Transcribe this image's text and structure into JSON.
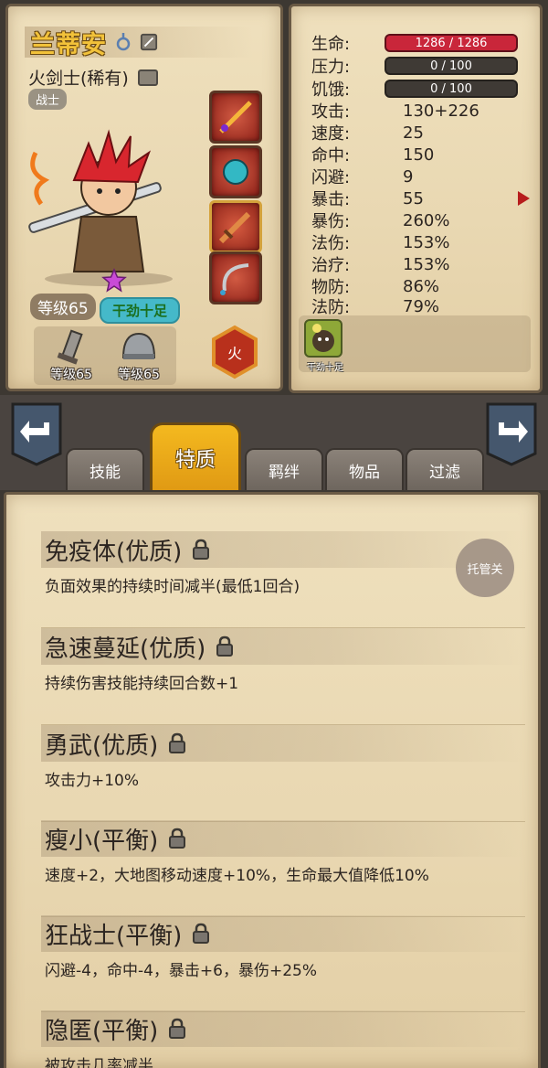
{
  "character": {
    "name": "兰蒂安",
    "class_line": "火剑士(稀有)",
    "role": "战士",
    "level": "等级65",
    "trait_tag": "干劲十足",
    "element": "火",
    "gear": [
      {
        "name": "sword",
        "level": "等级65"
      },
      {
        "name": "helmet",
        "level": "等级65"
      }
    ]
  },
  "stats": {
    "hp": {
      "label": "生命:",
      "value": "1286 / 1286"
    },
    "stress": {
      "label": "压力:",
      "value": "0 / 100"
    },
    "hunger": {
      "label": "饥饿:",
      "value": "0 / 100"
    },
    "rows": [
      {
        "label": "攻击:",
        "value": "130+226"
      },
      {
        "label": "速度:",
        "value": "25"
      },
      {
        "label": "命中:",
        "value": "150"
      },
      {
        "label": "闪避:",
        "value": "9"
      },
      {
        "label": "暴击:",
        "value": "55"
      },
      {
        "label": "暴伤:",
        "value": "260%"
      },
      {
        "label": "法伤:",
        "value": "153%"
      },
      {
        "label": "治疗:",
        "value": "153%"
      },
      {
        "label": "物防:",
        "value": "86%"
      },
      {
        "label": "法防:",
        "value": "79%"
      }
    ],
    "buff_label": "干劲十足"
  },
  "tabs": {
    "skills": "技能",
    "traits": "特质",
    "bonds": "羁绊",
    "items": "物品",
    "filter": "过滤"
  },
  "auto_button": "托管关",
  "traits": [
    {
      "name": "免疫体(优质)",
      "desc": "负面效果的持续时间减半(最低1回合)"
    },
    {
      "name": "急速蔓延(优质)",
      "desc": "持续伤害技能持续回合数+1"
    },
    {
      "name": "勇武(优质)",
      "desc": "攻击力+10%"
    },
    {
      "name": "瘦小(平衡)",
      "desc": "速度+2，大地图移动速度+10%，生命最大值降低10%"
    },
    {
      "name": "狂战士(平衡)",
      "desc": "闪避-4，命中-4，暴击+6，暴伤+25%"
    },
    {
      "name": "隐匿(平衡)",
      "desc": "被攻击几率减半"
    }
  ],
  "colors": {
    "parchment": "#efe0bd",
    "hp_bar": "#c9263a",
    "active_tab": "#f4b91f",
    "name_gold": "#f2c23a"
  }
}
